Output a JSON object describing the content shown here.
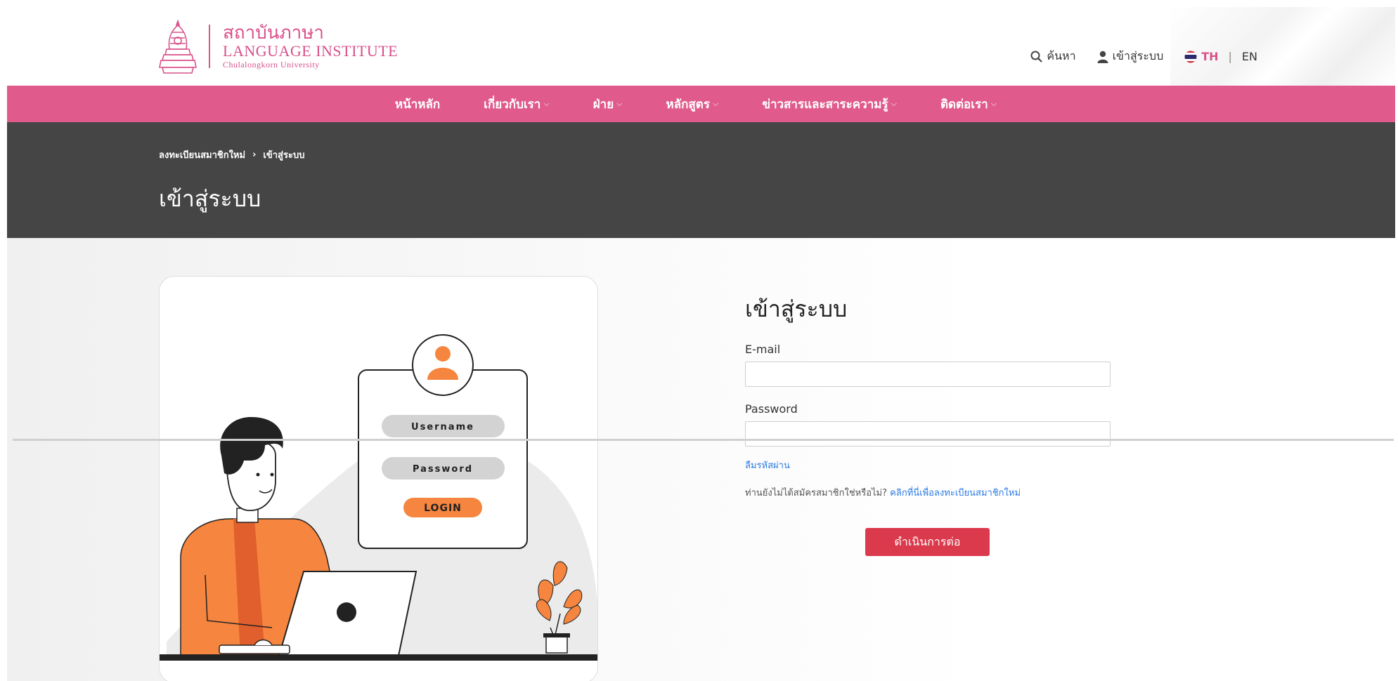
{
  "header": {
    "logo_th": "สถาบันภาษา",
    "logo_en": "LANGUAGE INSTITUTE",
    "logo_sub": "Chulalongkorn University",
    "search_label": "ค้นหา",
    "login_label": "เข้าสู่ระบบ",
    "lang_th": "TH",
    "lang_sep": "|",
    "lang_en": "EN",
    "brand_color": "#e05b8b"
  },
  "nav": {
    "items": [
      {
        "label": "หน้าหลัก",
        "has_dropdown": false
      },
      {
        "label": "เกี่ยวกับเรา",
        "has_dropdown": true
      },
      {
        "label": "ฝ่าย",
        "has_dropdown": true
      },
      {
        "label": "หลักสูตร",
        "has_dropdown": true
      },
      {
        "label": "ข่าวสารและสาระความรู้",
        "has_dropdown": true
      },
      {
        "label": "ติดต่อเรา",
        "has_dropdown": true
      }
    ]
  },
  "banner": {
    "breadcrumb": [
      "ลงทะเบียนสมาชิกใหม่",
      "เข้าสู่ระบบ"
    ],
    "breadcrumb_sep": "›",
    "title": "เข้าสู่ระบบ"
  },
  "illustration": {
    "username_label": "Username",
    "password_label": "Password",
    "login_button": "LOGIN"
  },
  "form": {
    "title": "เข้าสู่ระบบ",
    "email_label": "E-mail",
    "email_value": "",
    "password_label": "Password",
    "password_value": "",
    "forgot_label": "ลืมรหัสผ่าน",
    "register_prompt": "ท่านยังไม่ได้สมัครสมาชิกใช่หรือไม่?",
    "register_link": "คลิกที่นี่เพื่อลงทะเบียนสมาชิกใหม่",
    "submit_label": "ดำเนินการต่อ",
    "submit_color": "#db3a4d",
    "link_color": "#2c7be5"
  }
}
